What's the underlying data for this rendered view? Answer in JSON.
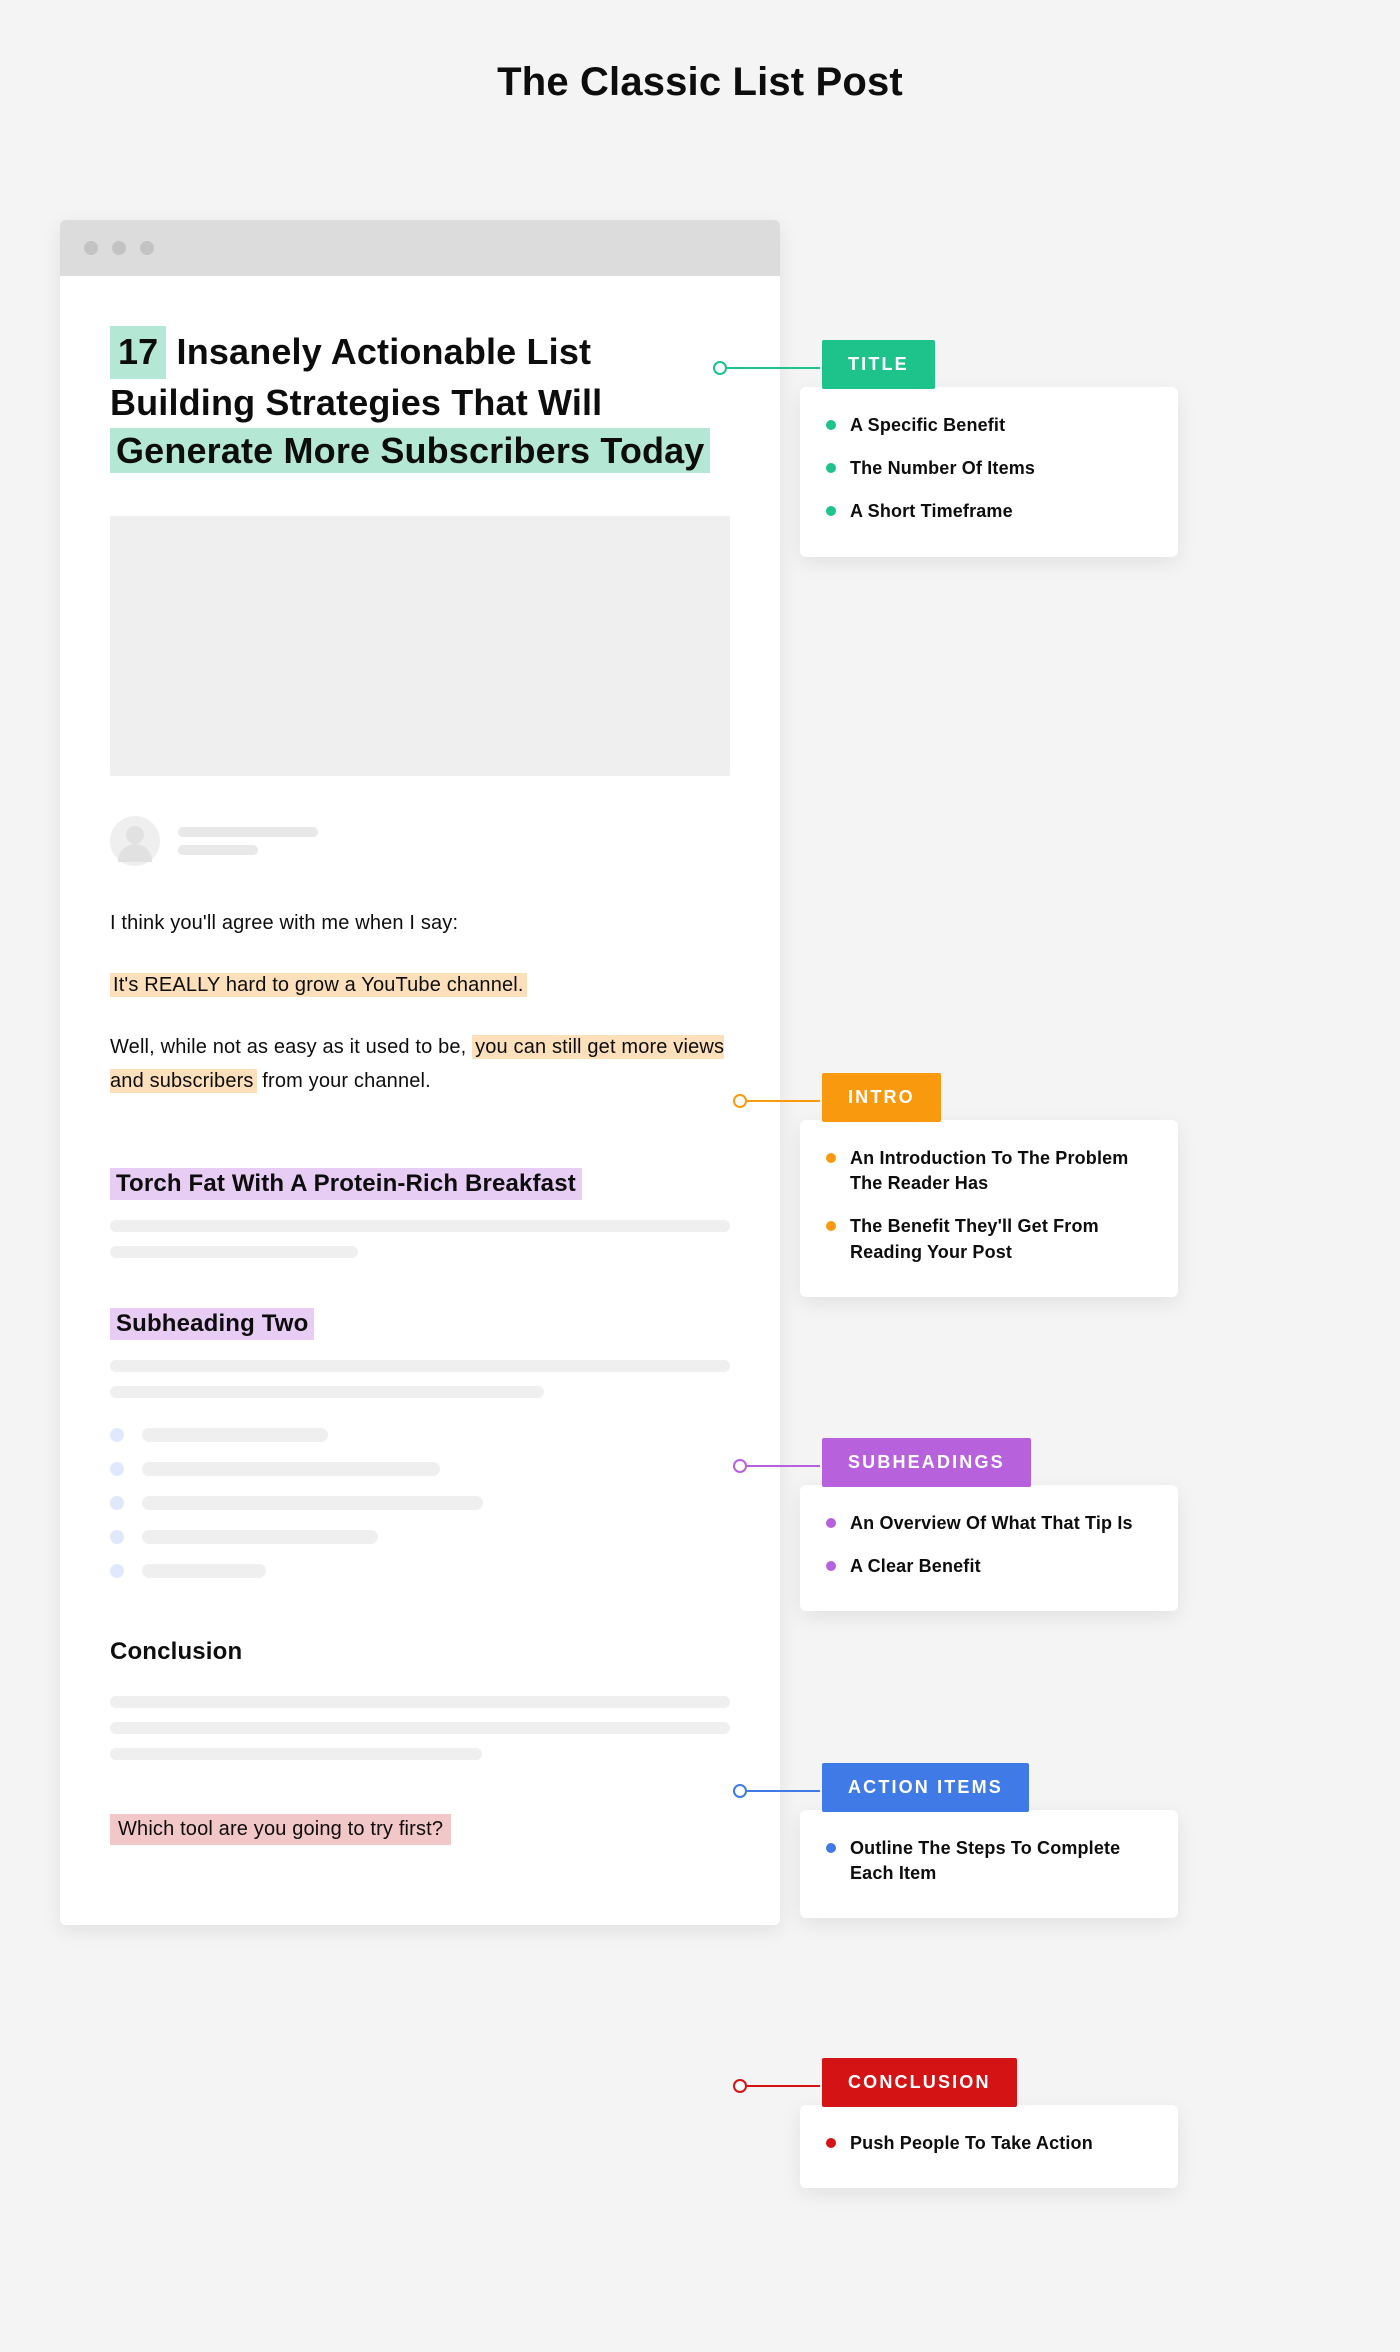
{
  "page": {
    "title": "The Classic List Post"
  },
  "article": {
    "title_number": "17",
    "title_mid": " Insanely Actionable List Building Strategies That Will ",
    "title_highlight": "Generate More Subscribers Today",
    "intro_line1": "I think you'll agree with me when I say:",
    "intro_hl1": "It's REALLY hard to grow a YouTube channel.",
    "intro_pre": "Well, while not as easy as it used to be, ",
    "intro_hl2": "you can still get more views and subscribers",
    "intro_post": " from your channel.",
    "subheading1": "Torch Fat With A Protein-Rich Breakfast",
    "subheading2": "Subheading Two",
    "conclusion_heading": "Conclusion",
    "conclusion_cta": "Which tool are you going to try first?"
  },
  "annotations": {
    "title": {
      "label": "TITLE",
      "color": "green",
      "items": [
        "A Specific Benefit",
        "The Number Of Items",
        "A Short Timeframe"
      ]
    },
    "intro": {
      "label": "INTRO",
      "color": "orange",
      "items": [
        "An Introduction To The Problem The Reader Has",
        "The Benefit They'll Get From Reading Your Post"
      ]
    },
    "subheadings": {
      "label": "SUBHEADINGS",
      "color": "purple",
      "items": [
        "An Overview Of What That Tip Is",
        "A Clear Benefit"
      ]
    },
    "action": {
      "label": "ACTION ITEMS",
      "color": "blue",
      "items": [
        "Outline The Steps To Complete Each Item"
      ]
    },
    "conclusion": {
      "label": "CONCLUSION",
      "color": "red",
      "items": [
        "Push People To Take Action"
      ]
    }
  },
  "colors": {
    "green": "#1ec28b",
    "orange": "#f99a0e",
    "purple": "#b761dd",
    "blue": "#3f7ae6",
    "red": "#d41314"
  }
}
